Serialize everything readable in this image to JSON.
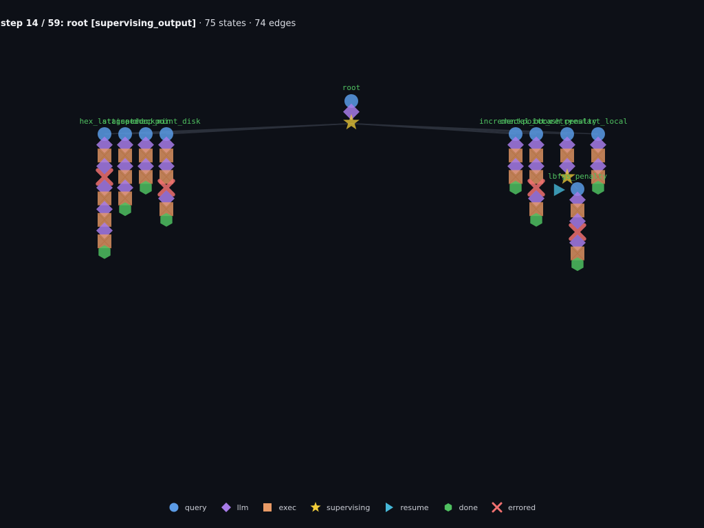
{
  "header": {
    "step_text": "step 14 / 59: root [supervising_output]",
    "counts_text": " · 75 states · 74 edges"
  },
  "colors": {
    "background": "#0d1017",
    "query": "#5b9be6",
    "llm": "#a77be8",
    "exec": "#e89a66",
    "supervising": "#f2cd3a",
    "resume": "#46b8d8",
    "done": "#4fc060",
    "errored": "#f07070",
    "label": "#4fc060",
    "edge": "#2b303b"
  },
  "legend": [
    {
      "kind": "query",
      "label": "query",
      "icon": "circle-icon"
    },
    {
      "kind": "llm",
      "label": "llm",
      "icon": "diamond-icon"
    },
    {
      "kind": "exec",
      "label": "exec",
      "icon": "square-icon"
    },
    {
      "kind": "supervising",
      "label": "supervising",
      "icon": "star-icon"
    },
    {
      "kind": "resume",
      "label": "resume",
      "icon": "triangle-icon"
    },
    {
      "kind": "done",
      "label": "done",
      "icon": "hexagon-icon"
    },
    {
      "kind": "errored",
      "label": "errored",
      "icon": "cross-icon"
    }
  ],
  "graph": {
    "root": {
      "label": "root",
      "sequence": [
        "query",
        "llm",
        "supervising"
      ]
    },
    "left_branches": [
      {
        "label": "hex_lattice",
        "sequence": [
          "query",
          "llm",
          "exec",
          "llm",
          "errored",
          "llm",
          "exec",
          "llm",
          "exec",
          "llm",
          "exec",
          "done"
        ]
      },
      {
        "label": "stagnation",
        "sequence": [
          "query",
          "llm",
          "exec",
          "llm",
          "exec",
          "llm",
          "exec",
          "done"
        ]
      },
      {
        "label": "speedup_min",
        "sequence": [
          "query",
          "llm",
          "exec",
          "llm",
          "exec",
          "done"
        ]
      },
      {
        "label": "checkpoint_disk",
        "sequence": [
          "query",
          "llm",
          "exec",
          "llm",
          "exec",
          "errored",
          "llm",
          "exec",
          "done"
        ]
      }
    ],
    "right_branches": [
      {
        "label": "incremental_bbox",
        "sequence": [
          "query",
          "llm",
          "exec",
          "llm",
          "exec",
          "done"
        ]
      },
      {
        "label": "checkpoint_retry",
        "sequence": [
          "query",
          "llm",
          "exec",
          "llm",
          "exec",
          "errored",
          "llm",
          "exec",
          "done"
        ]
      },
      {
        "label": "crash_penalty",
        "sequence": [
          "query",
          "llm",
          "exec",
          "llm",
          "supervising"
        ],
        "resume": true
      },
      {
        "label": "restart_local",
        "sequence": [
          "query",
          "llm",
          "exec",
          "llm",
          "exec",
          "done"
        ]
      }
    ],
    "sub_branch": {
      "label": "lbfgs_penalty",
      "sequence": [
        "query",
        "llm",
        "exec",
        "llm",
        "errored",
        "llm",
        "exec",
        "done"
      ]
    }
  }
}
